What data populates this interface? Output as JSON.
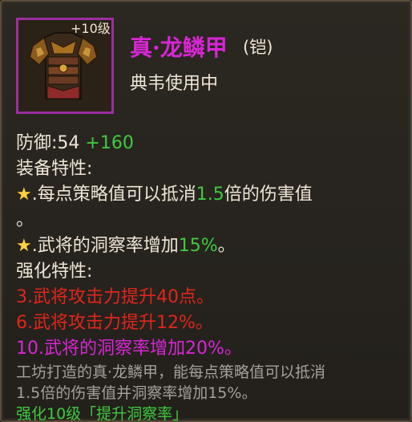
{
  "item": {
    "level_badge": "+10级",
    "name": "真·龙鳞甲",
    "type": "(铠)",
    "owner": "典韦使用中",
    "defense_label": "防御:54",
    "defense_bonus": "+160"
  },
  "equip_traits": {
    "title": "装备特性:",
    "trait1": {
      "star": "★",
      "prefix": ".每点策略值可以抵消",
      "value": "1.5",
      "suffix": "倍的伤害值",
      "wrap": "。"
    },
    "trait2": {
      "star": "★",
      "prefix": ".武将的洞察率增加",
      "value": "15%",
      "suffix": "。"
    }
  },
  "enhance_traits": {
    "title": "强化特性:",
    "items": [
      "3.武将攻击力提升40点。",
      "6.武将攻击力提升12%。",
      "10.武将的洞察率增加20%。"
    ]
  },
  "description": {
    "line1": "工坊打造的真·龙鳞甲，能每点策略值可以抵消",
    "line2": "1.5倍的伤害值并洞察率增加15%。"
  },
  "enhance_footer": "强化10级「提升洞察率」",
  "colors": {
    "name": "#d826d5",
    "frame": "#9b2fa0",
    "green": "#3fca3f",
    "red": "#e0261c",
    "star": "#ffd040"
  }
}
